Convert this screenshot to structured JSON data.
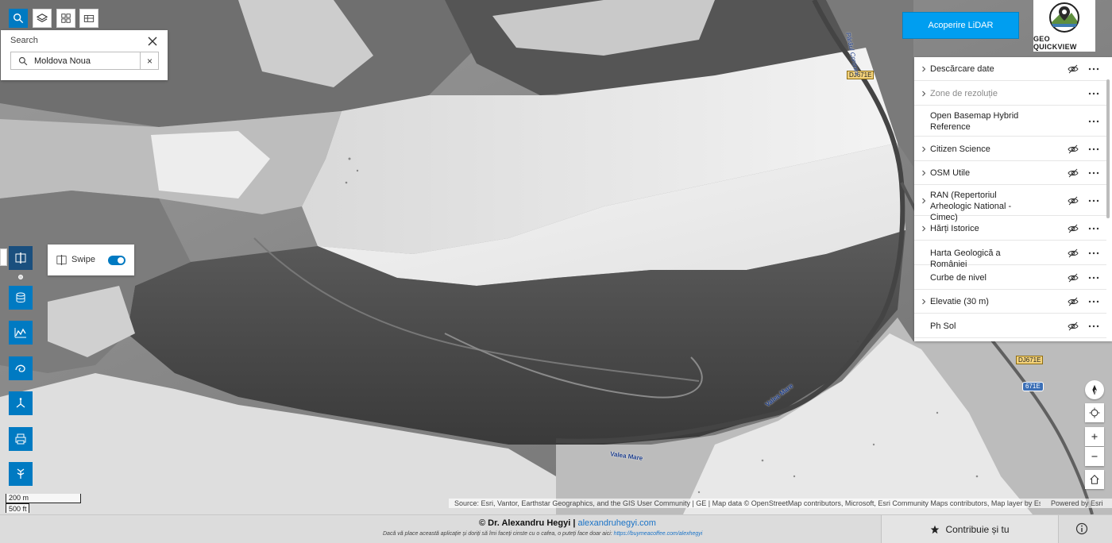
{
  "toolbar": {
    "search_icon": "search-icon",
    "layers_icon": "layers-icon",
    "basemap_icon": "basemap-gallery-icon",
    "table_icon": "table-icon"
  },
  "search": {
    "title": "Search",
    "value": "Moldova Noua",
    "clear_label": "×"
  },
  "swipe": {
    "label": "Swipe",
    "enabled": true
  },
  "lidar_button": "Acoperire LiDAR",
  "logo": {
    "text": "GEO QUICKVIEW"
  },
  "layers": [
    {
      "name": "Descărcare date",
      "expandable": true,
      "muted": false,
      "visibility_toggle": true
    },
    {
      "name": "Zone de rezoluție",
      "expandable": true,
      "muted": true,
      "visibility_toggle": false
    },
    {
      "name": "Open Basemap Hybrid Reference",
      "expandable": false,
      "muted": false,
      "visibility_toggle": false
    },
    {
      "name": "Citizen Science",
      "expandable": true,
      "muted": false,
      "visibility_toggle": true
    },
    {
      "name": "OSM Utile",
      "expandable": true,
      "muted": false,
      "visibility_toggle": true
    },
    {
      "name": "RAN (Repertoriul Arheologic National - Cimec)",
      "expandable": true,
      "muted": false,
      "visibility_toggle": true
    },
    {
      "name": "Hărți Istorice",
      "expandable": true,
      "muted": false,
      "visibility_toggle": true
    },
    {
      "name": "Harta Geologică a României",
      "expandable": false,
      "muted": false,
      "visibility_toggle": true
    },
    {
      "name": "Curbe de nivel",
      "expandable": false,
      "muted": false,
      "visibility_toggle": true
    },
    {
      "name": "Elevatie (30 m)",
      "expandable": true,
      "muted": false,
      "visibility_toggle": true
    },
    {
      "name": "Ph Sol",
      "expandable": false,
      "muted": false,
      "visibility_toggle": true
    }
  ],
  "map_labels": {
    "road_top": "DJ671E",
    "road_right": "DJ671E",
    "road_shield": "671E",
    "stream_top": "Pârâul Coronini",
    "valley_lower": "Valea Mare",
    "valley_right": "Valea Mare"
  },
  "scale": {
    "metric": "200 m",
    "imperial": "500 ft"
  },
  "attribution": {
    "source": "Source: Esri, Vantor, Earthstar Geographics, and the GIS User Community | GE | Map data © OpenStreetMap contributors, Microsoft, Esri Community Maps contributors, Map layer by Es...",
    "powered": "Powered by Esri"
  },
  "footer": {
    "author": "© Dr. Alexandru Hegyi |",
    "site": "alexandruhegyi.com",
    "note": "Dacă vă place această aplicație și doriți să îmi faceți cinste cu o cafea, o puteți face doar aici:",
    "coffee_link": "https://buymeacoffee.com/alexhegyi",
    "contribute": "Contribuie și tu"
  },
  "colors": {
    "accent": "#007ac2",
    "lidar": "#009ef0",
    "dark_tool": "#1a4f7e"
  }
}
